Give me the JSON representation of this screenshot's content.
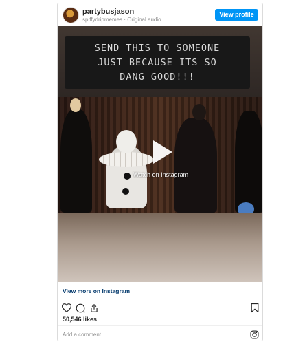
{
  "post": {
    "username": "partybusjason",
    "subline": "spiffydripmemes · Original audio",
    "view_profile_label": "View profile"
  },
  "media": {
    "caption_lines": [
      "SEND THIS TO SOMEONE",
      "JUST BECAUSE ITS SO",
      "DANG GOOD!!!"
    ],
    "watch_label": "Watch on Instagram"
  },
  "footer": {
    "view_more_label": "View more on Instagram",
    "likes": "50,546 likes",
    "comment_placeholder": "Add a comment..."
  },
  "icons": {
    "like": "heart-icon",
    "comment": "comment-icon",
    "share": "share-icon",
    "save": "bookmark-icon",
    "instagram": "instagram-logo-icon",
    "play": "play-icon"
  },
  "colors": {
    "accent": "#0095f6",
    "link": "#00376b",
    "muted": "#8e8e8e",
    "text": "#262626"
  }
}
